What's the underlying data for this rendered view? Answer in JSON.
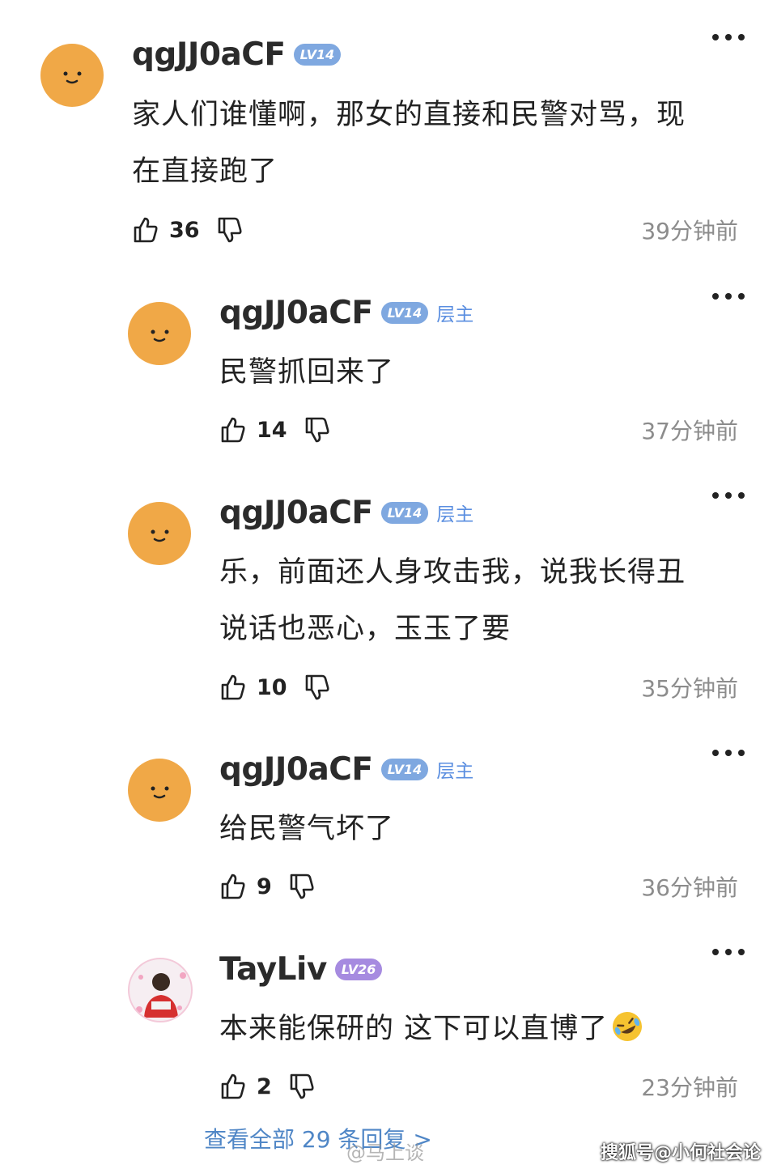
{
  "comments": [
    {
      "username": "qgJJ0aCF",
      "level": "LV14",
      "op_tag": "",
      "lines": [
        "家人们谁懂啊，那女的直接和民警对骂，现",
        "在直接跑了"
      ],
      "likes": "36",
      "time": "39分钟前"
    },
    {
      "username": "qgJJ0aCF",
      "level": "LV14",
      "op_tag": "层主",
      "lines": [
        "民警抓回来了"
      ],
      "likes": "14",
      "time": "37分钟前"
    },
    {
      "username": "qgJJ0aCF",
      "level": "LV14",
      "op_tag": "层主",
      "lines": [
        "乐，前面还人身攻击我，说我长得丑",
        "说话也恶心，玉玉了要"
      ],
      "likes": "10",
      "time": "35分钟前"
    },
    {
      "username": "qgJJ0aCF",
      "level": "LV14",
      "op_tag": "层主",
      "lines": [
        "给民警气坏了"
      ],
      "likes": "9",
      "time": "36分钟前"
    },
    {
      "username": "TayLiv",
      "level": "LV26",
      "op_tag": "",
      "lines": [
        "本来能保研的 这下可以直博了"
      ],
      "likes": "2",
      "time": "23分钟前"
    }
  ],
  "view_all_replies": "查看全部 29 条回复 >",
  "watermarks": [
    "@马上谈",
    "搜狐号@小何社会论"
  ],
  "icons": [
    "more-icon",
    "like-icon",
    "dislike-icon",
    "rofl-emoji"
  ],
  "colors": {
    "badge_lv14": "#7fa8e0",
    "badge_lv26": "#a68be0",
    "op_tag": "#5a8ee0",
    "link": "#4f86c6"
  }
}
